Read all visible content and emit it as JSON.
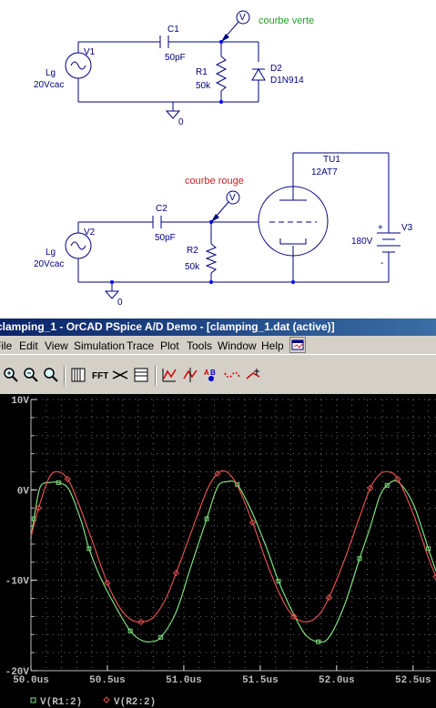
{
  "schematic": {
    "circuit1": {
      "source_ref": "V1",
      "source_name": "Lg",
      "source_value": "20Vcac",
      "cap_ref": "C1",
      "cap_value": "50pF",
      "res_ref": "R1",
      "res_value": "50k",
      "diode_ref": "D2",
      "diode_part": "D1N914",
      "ground_label": "0",
      "probe_label": "V",
      "probe_note": "courbe verte"
    },
    "circuit2": {
      "source_ref": "V2",
      "source_name": "Lg",
      "source_value": "20Vcac",
      "cap_ref": "C2",
      "cap_value": "50pF",
      "res_ref": "R2",
      "res_value": "50k",
      "tube_ref": "TU1",
      "tube_part": "12AT7",
      "battery_ref": "V3",
      "battery_value": "180V",
      "battery_plus": "+",
      "battery_minus": "-",
      "ground_label": "0",
      "probe_label": "V",
      "probe_note": "courbe rouge"
    },
    "colors": {
      "wire": "#000080",
      "note_green": "#2a9a2a",
      "note_red": "#cc2020",
      "junction": "#0000ff"
    }
  },
  "window": {
    "title": "clamping_1 - OrCAD PSpice A/D Demo  - [clamping_1.dat (active)]",
    "menu": [
      "File",
      "Edit",
      "View",
      "Simulation",
      "Trace",
      "Plot",
      "Tools",
      "Window",
      "Help"
    ],
    "toolbar": [
      "zoom-in-icon",
      "zoom-out-icon",
      "zoom-area-icon",
      "zoom-fit-icon",
      "axis-settings-icon",
      "fft-icon",
      "performance-analysis-icon",
      "add-trace-icon",
      "toggle-cursor-icon",
      "cursor-peak-icon",
      "mark-label-icon",
      "mark-data-points-icon",
      "measure-icon"
    ]
  },
  "chart_data": {
    "type": "line",
    "xlim": [
      50.0,
      52.65
    ],
    "ylim": [
      -20,
      10
    ],
    "x_ticks": [
      "50.0us",
      "50.5us",
      "51.0us",
      "51.5us",
      "52.0us",
      "52.5us"
    ],
    "x_tick_values": [
      50.0,
      50.5,
      51.0,
      51.5,
      52.0,
      52.5
    ],
    "y_ticks": [
      "10V",
      "0V",
      "-10V",
      "-20V"
    ],
    "y_tick_values": [
      10,
      0,
      -10,
      -20
    ],
    "grid": true,
    "legend_position": "bottom-left",
    "series": [
      {
        "name": "V(R1:2)",
        "color": "#7fe07f",
        "marker": "square",
        "points": [
          [
            50.0,
            -5.4
          ],
          [
            50.02,
            -3.2
          ],
          [
            50.06,
            0.3
          ],
          [
            50.12,
            0.8
          ],
          [
            50.18,
            0.8
          ],
          [
            50.25,
            0.0
          ],
          [
            50.33,
            -3.5
          ],
          [
            50.38,
            -6.5
          ],
          [
            50.45,
            -9.5
          ],
          [
            50.55,
            -12.8
          ],
          [
            50.65,
            -15.6
          ],
          [
            50.72,
            -16.6
          ],
          [
            50.78,
            -16.8
          ],
          [
            50.85,
            -16.3
          ],
          [
            50.95,
            -13.5
          ],
          [
            51.05,
            -8.3
          ],
          [
            51.15,
            -3.2
          ],
          [
            51.22,
            0.3
          ],
          [
            51.28,
            0.9
          ],
          [
            51.35,
            0.6
          ],
          [
            51.45,
            -2.6
          ],
          [
            51.55,
            -6.8
          ],
          [
            51.62,
            -10.1
          ],
          [
            51.72,
            -13.8
          ],
          [
            51.8,
            -16.1
          ],
          [
            51.88,
            -16.8
          ],
          [
            51.95,
            -16.3
          ],
          [
            52.05,
            -12.8
          ],
          [
            52.15,
            -7.6
          ],
          [
            52.22,
            -4.1
          ],
          [
            52.28,
            -0.8
          ],
          [
            52.33,
            0.5
          ],
          [
            52.4,
            0.9
          ],
          [
            52.5,
            -1.5
          ],
          [
            52.6,
            -6.5
          ],
          [
            52.65,
            -9.0
          ]
        ]
      },
      {
        "name": "V(R2:2)",
        "color": "#e05050",
        "marker": "diamond",
        "points": [
          [
            50.0,
            -5.2
          ],
          [
            50.05,
            -2.0
          ],
          [
            50.12,
            1.4
          ],
          [
            50.18,
            2.0
          ],
          [
            50.24,
            1.2
          ],
          [
            50.3,
            -1.0
          ],
          [
            50.4,
            -5.6
          ],
          [
            50.5,
            -10.3
          ],
          [
            50.58,
            -13.0
          ],
          [
            50.65,
            -14.3
          ],
          [
            50.72,
            -14.6
          ],
          [
            50.8,
            -14.1
          ],
          [
            50.88,
            -12.1
          ],
          [
            50.95,
            -9.2
          ],
          [
            51.05,
            -4.6
          ],
          [
            51.15,
            -0.1
          ],
          [
            51.22,
            1.8
          ],
          [
            51.28,
            2.0
          ],
          [
            51.35,
            0.5
          ],
          [
            51.45,
            -3.6
          ],
          [
            51.55,
            -8.4
          ],
          [
            51.65,
            -12.3
          ],
          [
            51.72,
            -14.0
          ],
          [
            51.8,
            -14.6
          ],
          [
            51.88,
            -13.9
          ],
          [
            51.95,
            -11.9
          ],
          [
            52.05,
            -7.8
          ],
          [
            52.15,
            -3.0
          ],
          [
            52.22,
            0.2
          ],
          [
            52.28,
            1.7
          ],
          [
            52.34,
            2.0
          ],
          [
            52.4,
            1.2
          ],
          [
            52.5,
            -2.6
          ],
          [
            52.6,
            -7.5
          ],
          [
            52.65,
            -9.6
          ]
        ]
      }
    ]
  }
}
